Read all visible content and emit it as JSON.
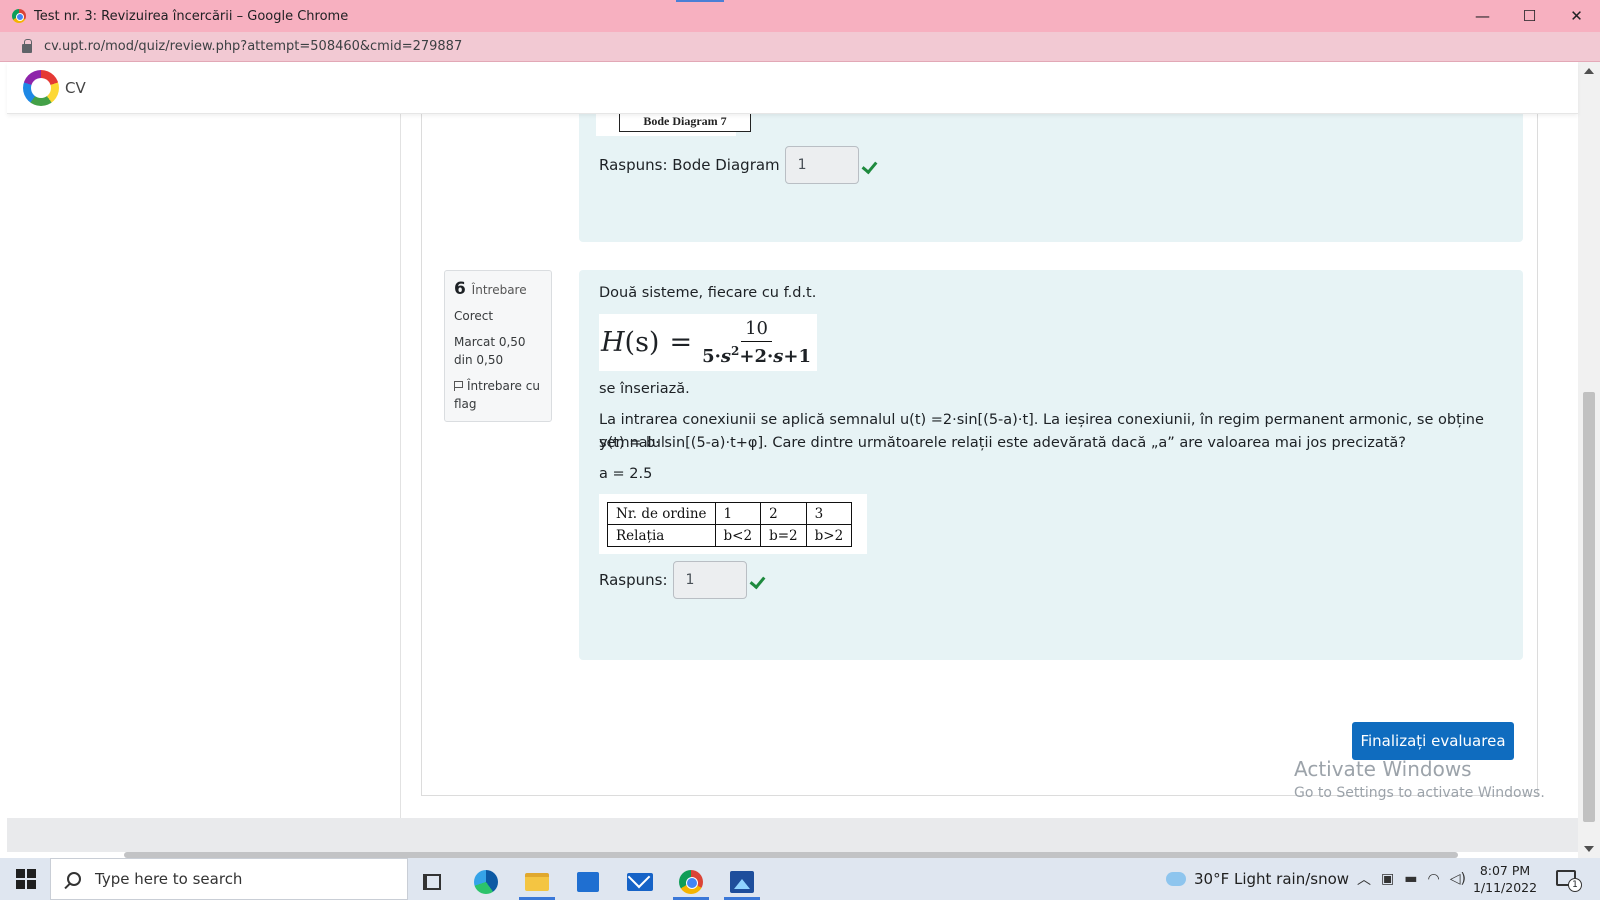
{
  "window": {
    "title": "Test nr. 3: Revizuirea încercării – Google Chrome",
    "minimize": "—",
    "maximize": "☐",
    "close": "✕"
  },
  "browser": {
    "url": "cv.upt.ro/mod/quiz/review.php?attempt=508460&cmid=279887"
  },
  "site": {
    "name": "CV"
  },
  "question5": {
    "figure_label": "Bode Diagram 7",
    "answer_prefix": "Raspuns: Bode Diagram",
    "answer_value": "1"
  },
  "question6": {
    "number": "6",
    "word": "Întrebare",
    "status": "Corect",
    "mark": "Marcat 0,50 din 0,50",
    "flag_label": "Întrebare cu flag",
    "intro": "Două sisteme, fiecare cu f.d.t.",
    "formula": {
      "lhs": "H",
      "arg": "(s)",
      "eq": "=",
      "numerator": "10",
      "denominator_parts": [
        "5·",
        "s",
        "2",
        "+2·",
        "s",
        "+1"
      ]
    },
    "after_formula": "se înseriază.",
    "body_line1": "La intrarea conexiunii se aplică semnalul u(t) =2·sin[(5-a)·t]. La ieșirea conexiunii, în regim permanent armonic, se obține semnalul",
    "body_line2": "y(t) = b· sin[(5-a)·t+φ]. Care dintre următoarele relații este adevărată dacă „a” are valoarea mai jos precizată?",
    "a_value": "a = 2.5",
    "table": {
      "row1": [
        "Nr. de ordine",
        "1",
        "2",
        "3"
      ],
      "row2": [
        "Relația",
        "b<2",
        "b=2",
        "b>2"
      ]
    },
    "answer_prefix": "Raspuns:",
    "answer_value": "1"
  },
  "finish_button": "Finalizați evaluarea",
  "activation": {
    "line1": "Activate Windows",
    "line2": "Go to Settings to activate Windows."
  },
  "taskbar": {
    "search_placeholder": "Type here to search",
    "weather": "30°F  Light rain/snow",
    "time": "8:07 PM",
    "date": "1/11/2022",
    "notification_count": "1"
  }
}
